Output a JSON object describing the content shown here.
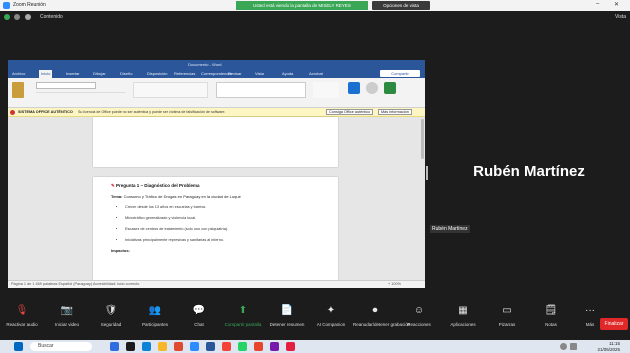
{
  "zoom": {
    "title": "Zoom Reunión",
    "share_banner": "Usted está viendo la pantalla de MISELY REYES",
    "view_options": "Opciones de vista",
    "toolbar_label": "Contenido",
    "view_label": "Vista",
    "participant_name": "Rubén Martínez",
    "thumbnail_name": "Rubén Martínez",
    "controls": [
      {
        "icon": "mic-icon",
        "glyph": "🎙",
        "label": "Reactivar audio"
      },
      {
        "icon": "video-icon",
        "glyph": "📷",
        "label": "Iniciar video"
      },
      {
        "icon": "shield-icon",
        "glyph": "🛡",
        "label": "Seguridad"
      },
      {
        "icon": "participants-icon",
        "glyph": "👥",
        "label": "Participantes"
      },
      {
        "icon": "chat-icon",
        "glyph": "💬",
        "label": "Chat"
      },
      {
        "icon": "share-icon",
        "glyph": "⬆",
        "label": "Compartir pantalla"
      },
      {
        "icon": "summary-icon",
        "glyph": "📄",
        "label": "Detener resumen"
      },
      {
        "icon": "ai-companion-icon",
        "glyph": "✦",
        "label": "AI Companion"
      },
      {
        "icon": "record-icon",
        "glyph": "⏺",
        "label": "Reanudar/detener grabación"
      },
      {
        "icon": "reactions-icon",
        "glyph": "☺",
        "label": "Reacciones"
      },
      {
        "icon": "apps-icon",
        "glyph": "▦",
        "label": "Aplicaciones"
      },
      {
        "icon": "whiteboard-icon",
        "glyph": "▭",
        "label": "Pizarras"
      },
      {
        "icon": "notes-icon",
        "glyph": "🗒",
        "label": "Notas"
      },
      {
        "icon": "more-icon",
        "glyph": "···",
        "label": "Más"
      }
    ],
    "finish_label": "Finalizar"
  },
  "word": {
    "title": "Documento - Word",
    "tabs": [
      "Archivo",
      "Inicio",
      "Insertar",
      "Dibujar",
      "Diseño",
      "Disposición",
      "Referencias",
      "Correspondencia",
      "Revisar",
      "Vista",
      "Ayuda",
      "Acrobat"
    ],
    "share_btn": "Compartir",
    "warning_title": "SISTEMA OFFICE AUTÉNTICO",
    "warning_text": "Su licencia de Office puede no ser auténtica y puede ser víctima de falsificación de software.",
    "warning_btn1": "Consiga Office auténtico",
    "warning_btn2": "Más información",
    "heading": "Pregunta 1 – Diagnóstico del Problema",
    "tema_label": "Tema:",
    "tema_text": "Consumo y Tráfico de Drogas en Paraguay en la ciudad de Luque",
    "bullets": [
      "Crecer desde los 13 años en escuelas y barrios.",
      "Microtráfico generalizado y violencia local.",
      "Escasez de centros de tratamiento (solo uno con psiquiatría).",
      "Iniciativas principalmente represivas y sanitarias al interno."
    ],
    "impacts": "Impactos:",
    "status_left": "Página 1 de 1   469 palabras   Español (Paraguay)   Accesibilidad: todo correcto",
    "zoom_level": "+ 100%"
  },
  "taskbar": {
    "search_placeholder": "Buscar",
    "time": "11:15",
    "date": "21/05/2025"
  }
}
